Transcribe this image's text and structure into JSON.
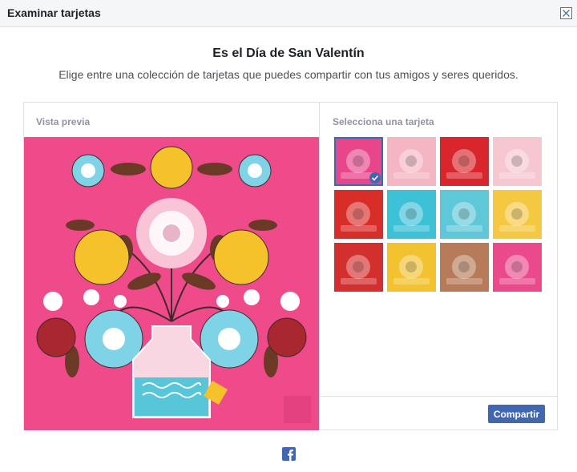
{
  "dialog": {
    "title": "Examinar tarjetas",
    "close_icon": "close-icon"
  },
  "header": {
    "title": "Es el Día de San Valentín",
    "subtitle": "Elige entre una colección de tarjetas que puedes compartir con tus amigos y seres queridos."
  },
  "preview": {
    "label": "Vista previa"
  },
  "selector": {
    "label": "Selecciona una tarjeta",
    "cards": [
      {
        "name": "floral-vase",
        "bg": "#e8458b",
        "selected": true
      },
      {
        "name": "pink-rose",
        "bg": "#f4b6c2"
      },
      {
        "name": "cat-window",
        "bg": "#d8262c"
      },
      {
        "name": "love-letters",
        "bg": "#f6c7d0"
      },
      {
        "name": "cat-cuddle",
        "bg": "#d92d2a"
      },
      {
        "name": "heart-pizza",
        "bg": "#3cc1d6"
      },
      {
        "name": "rabbit-skateboard",
        "bg": "#5fc8d8"
      },
      {
        "name": "gorilla",
        "bg": "#f5c842"
      },
      {
        "name": "scooter-couple",
        "bg": "#d42f2f"
      },
      {
        "name": "love-envelope",
        "bg": "#f2c230"
      },
      {
        "name": "stamps-xo",
        "bg": "#b77b5a"
      },
      {
        "name": "ice-cream",
        "bg": "#ea4a8c"
      }
    ]
  },
  "actions": {
    "share_label": "Compartir"
  },
  "colors": {
    "accent": "#4267b2",
    "card_pink": "#ef4b8a"
  }
}
